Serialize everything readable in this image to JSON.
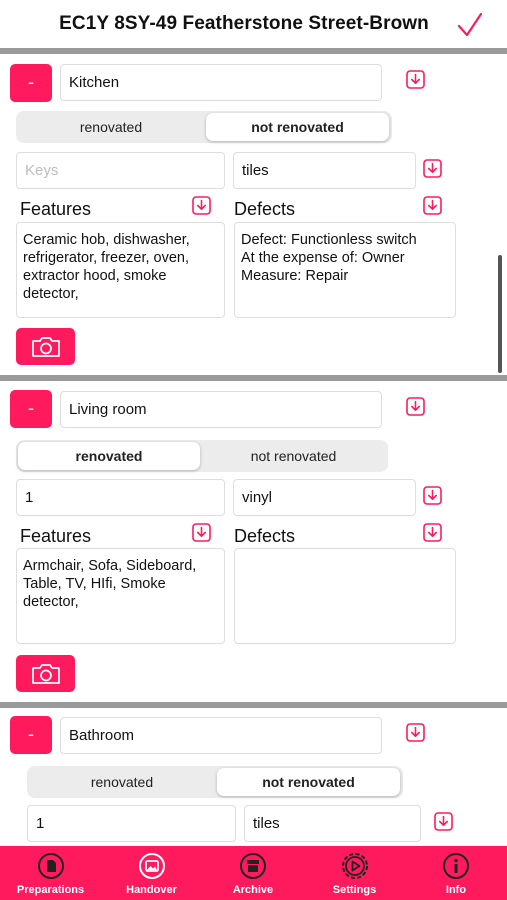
{
  "header": {
    "title": "EC1Y 8SY-49 Featherstone Street-Brown"
  },
  "rooms": [
    {
      "remove_label": "-",
      "name": "Kitchen",
      "segment": {
        "options": [
          "renovated",
          "not renovated"
        ],
        "selected": "not renovated"
      },
      "quantity": {
        "value": "",
        "placeholder": "Keys"
      },
      "floor": "tiles",
      "features_label": "Features",
      "features_text": "Ceramic hob, dishwasher, refrigerator, freezer, oven, extractor hood, smoke detector,",
      "defects_label": "Defects",
      "defects_text": "Defect: Functionless switch\nAt the expense of: Owner\nMeasure: Repair"
    },
    {
      "remove_label": "-",
      "name": "Living room",
      "segment": {
        "options": [
          "renovated",
          "not renovated"
        ],
        "selected": "renovated"
      },
      "quantity": {
        "value": "1",
        "placeholder": ""
      },
      "floor": "vinyl",
      "features_label": "Features",
      "features_text": "Armchair, Sofa, Sideboard, Table, TV, HIfi, Smoke detector,",
      "defects_label": "Defects",
      "defects_text": ""
    },
    {
      "remove_label": "-",
      "name": "Bathroom",
      "segment": {
        "options": [
          "renovated",
          "not renovated"
        ],
        "selected": "not renovated"
      },
      "quantity": {
        "value": "1",
        "placeholder": ""
      },
      "floor": "tiles"
    }
  ],
  "tabs": [
    {
      "label": "Preparations",
      "icon": "document-circle-icon"
    },
    {
      "label": "Handover",
      "icon": "image-circle-icon"
    },
    {
      "label": "Archive",
      "icon": "archive-circle-icon"
    },
    {
      "label": "Settings",
      "icon": "gear-icon"
    },
    {
      "label": "Info",
      "icon": "info-icon"
    }
  ],
  "colors": {
    "accent": "#ff1a5e",
    "separator": "#9a9a9a",
    "segment_bg": "#ececec"
  }
}
